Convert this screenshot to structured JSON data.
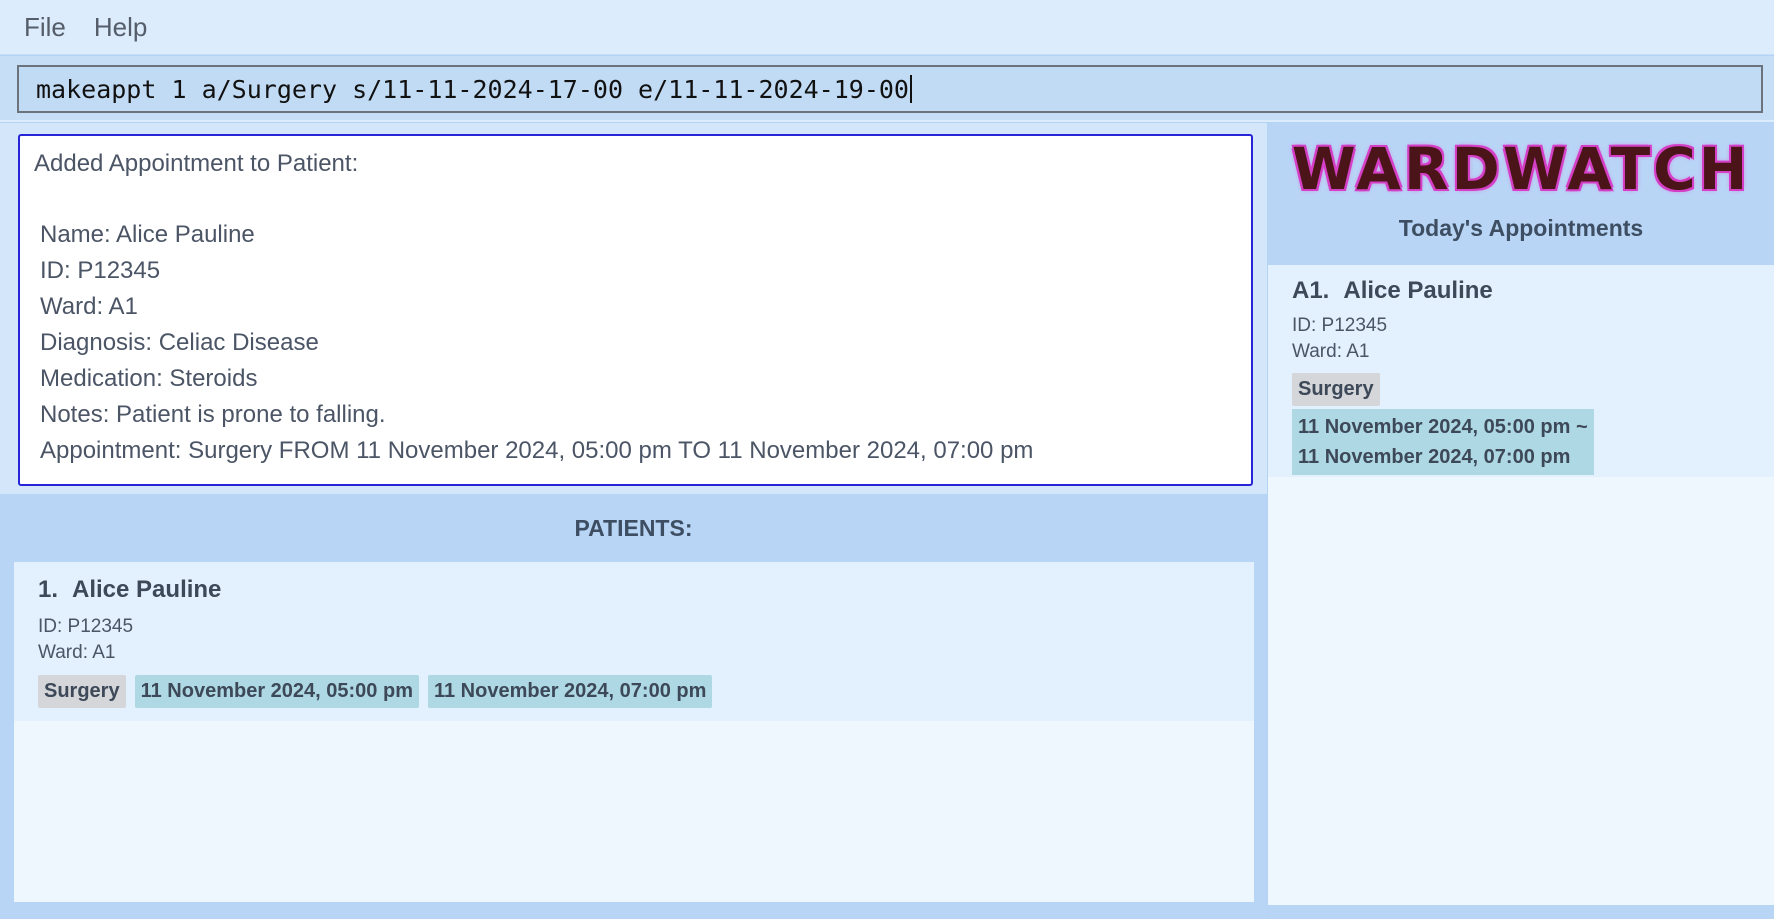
{
  "menu": {
    "file": "File",
    "help": "Help"
  },
  "command": {
    "value": "makeappt 1 a/Surgery s/11-11-2024-17-00 e/11-11-2024-19-00"
  },
  "result": {
    "heading": "Added Appointment to Patient:",
    "lines": [
      "Name: Alice Pauline",
      "ID: P12345",
      "Ward: A1",
      "Diagnosis: Celiac Disease",
      "Medication: Steroids",
      "Notes: Patient is prone to falling.",
      "Appointment: Surgery FROM 11 November 2024, 05:00 pm TO 11 November 2024, 07:00 pm"
    ]
  },
  "patients": {
    "title": "PATIENTS:",
    "items": [
      {
        "index": "1.",
        "name": "Alice Pauline",
        "id": "ID: P12345",
        "ward": "Ward: A1",
        "tags": [
          "Surgery",
          "11 November 2024, 05:00 pm",
          "11 November 2024, 07:00 pm"
        ]
      }
    ]
  },
  "right": {
    "logo": "WARDWATCH",
    "title": "Today's Appointments",
    "appointments": [
      {
        "index": "A1.",
        "name": "Alice Pauline",
        "id": "ID: P12345",
        "ward": "Ward: A1",
        "tag": "Surgery",
        "time_from": "11 November 2024, 05:00 pm ~",
        "time_to": "11 November 2024, 07:00 pm"
      }
    ]
  },
  "colors": {
    "result_border": "#2626d8",
    "tag_gray": "#d4d6d9",
    "tag_teal": "#aed9e4",
    "logo_fill": "#4a1419",
    "logo_outline": "#d53fc6"
  }
}
